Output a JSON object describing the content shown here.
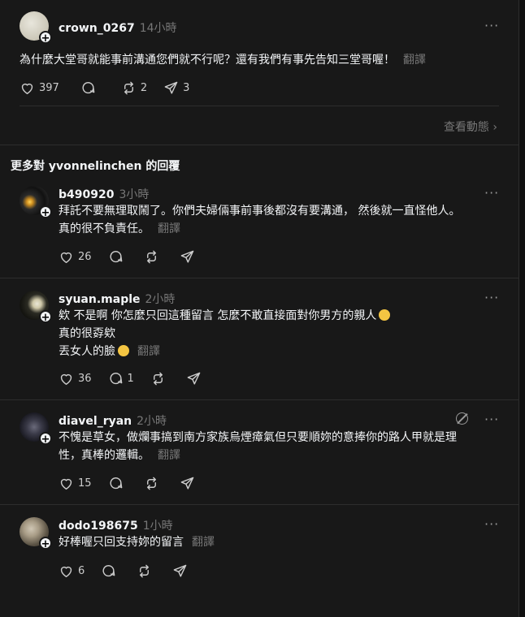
{
  "top_post": {
    "username": "crown_0267",
    "time": "14小時",
    "text": "為什麼大堂哥就能事前溝通您們就不行呢？還有我們有事先告知三堂哥喔！",
    "translate": "翻譯",
    "likes": "397",
    "replies": "",
    "reposts": "2",
    "shares": "3"
  },
  "view_activity": "查看動態",
  "section_title": "更多對 yvonnelinchen 的回覆",
  "replies": [
    {
      "username": "b490920",
      "time": "3小時",
      "lines": [
        "拜託不要無理取鬧了。你們夫婦倆事前事後都沒有要溝通， 然後就一直怪他人。",
        "真的很不負責任。"
      ],
      "translate": "翻譯",
      "likes": "26",
      "replies": "",
      "reposts": ""
    },
    {
      "username": "syuan.maple",
      "time": "2小時",
      "lines": [
        "欸 不是啊 你怎麼只回這種留言 怎麼不敢直接面對你男方的親人",
        "真的很孬欸",
        "丟女人的臉"
      ],
      "translate": "翻譯",
      "likes": "36",
      "replies": "1",
      "reposts": ""
    },
    {
      "username": "diavel_ryan",
      "time": "2小時",
      "lines": [
        "不愧是草女，做爛事搞到南方家族烏煙瘴氣但只要順妳的意捧你的路人甲就是理",
        "性，真棒的邏輯。"
      ],
      "translate": "翻譯",
      "likes": "15",
      "replies": "",
      "reposts": ""
    },
    {
      "username": "dodo198675",
      "time": "1小時",
      "lines": [
        "好棒喔只回支持妳的留言"
      ],
      "translate": "翻譯",
      "likes": "6",
      "replies": "",
      "reposts": ""
    }
  ],
  "icons": {
    "like": "heart-icon",
    "reply": "comment-icon",
    "repost": "repost-icon",
    "share": "send-icon",
    "more": "more-icon",
    "follow": "plus-icon"
  },
  "colors": {
    "background": "#101010",
    "panel": "#181818",
    "text": "#f3f5f7",
    "muted": "#777777",
    "divider": "#2d2d2d"
  }
}
